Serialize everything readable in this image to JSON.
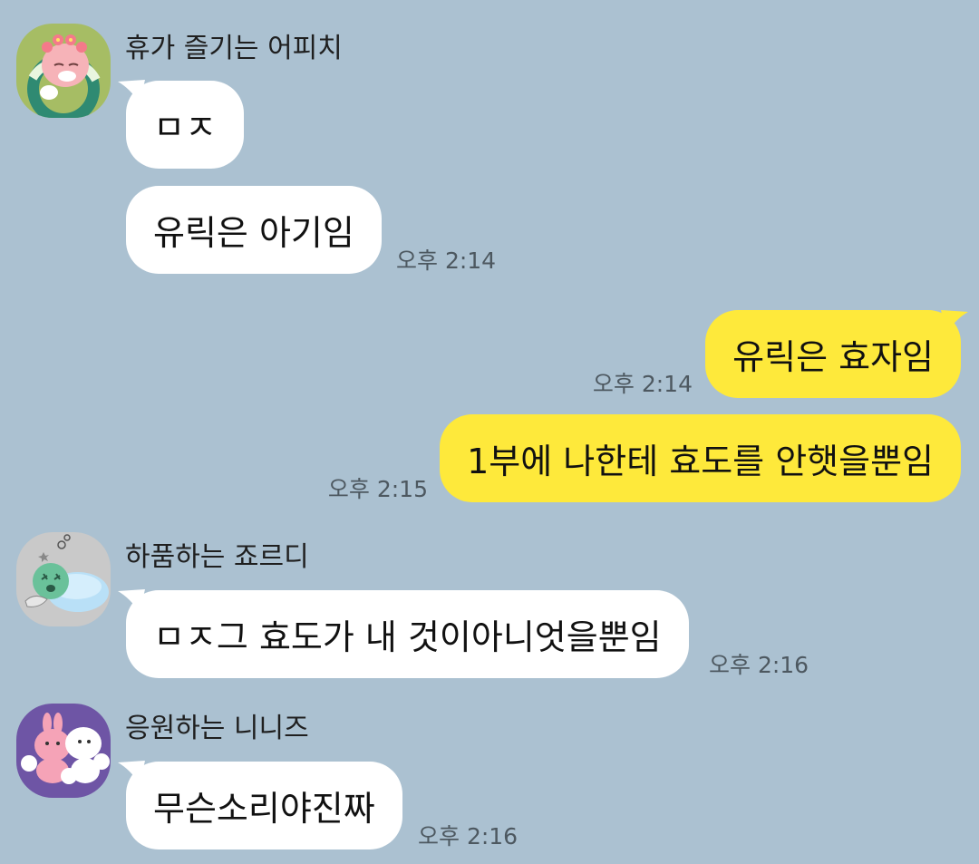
{
  "chat": {
    "groups": [
      {
        "sender": "휴가 즐기는 어피치",
        "avatar_icon": "apeach-on-swim-ring-icon",
        "messages": [
          {
            "text": "ㅁㅈ",
            "time": ""
          },
          {
            "text": "유릭은 아기임",
            "time": "오후 2:14"
          }
        ]
      },
      {
        "sender": "me",
        "messages": [
          {
            "text": "유릭은 효자임",
            "time": "오후 2:14"
          },
          {
            "text": "1부에 나한테 효도를 안햇을뿐임",
            "time": "오후 2:15"
          }
        ]
      },
      {
        "sender": "하품하는 죠르디",
        "avatar_icon": "jordy-yawning-icon",
        "messages": [
          {
            "text": "ㅁㅈ그 효도가 내 것이아니엇을뿐임",
            "time": "오후 2:16"
          }
        ]
      },
      {
        "sender": "응원하는 니니즈",
        "avatar_icon": "niniz-cheering-icon",
        "messages": [
          {
            "text": "무슨소리야진짜",
            "time": "오후 2:16"
          }
        ]
      }
    ]
  },
  "colors": {
    "background": "#abc1d1",
    "incoming_bubble": "#ffffff",
    "outgoing_bubble": "#fee93b",
    "timestamp": "#4d5860"
  }
}
